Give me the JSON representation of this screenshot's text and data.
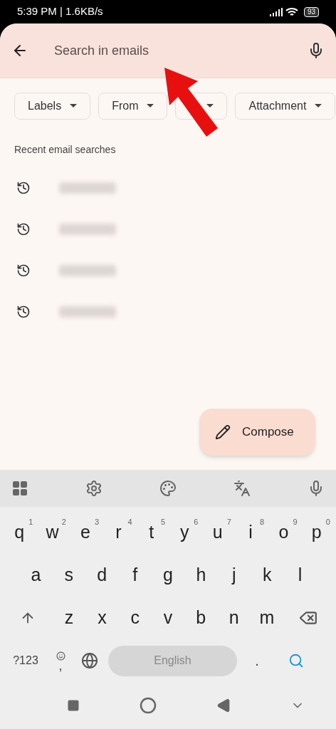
{
  "status_bar": {
    "time": "5:39 PM | 1.6KB/s",
    "battery": "93"
  },
  "search": {
    "placeholder": "Search in emails"
  },
  "filter_chips": [
    {
      "kind": "labeled",
      "label": "Labels"
    },
    {
      "kind": "labeled",
      "label": "From"
    },
    {
      "kind": "covered"
    },
    {
      "kind": "labeled",
      "label": "Attachment"
    }
  ],
  "recent_searches": {
    "title": "Recent email searches",
    "items": [
      {
        "kind": "redacted"
      },
      {
        "kind": "redacted"
      },
      {
        "kind": "redacted"
      },
      {
        "kind": "redacted"
      }
    ]
  },
  "compose_button": {
    "label": "Compose"
  },
  "keyboard": {
    "rows": [
      [
        {
          "key": "q",
          "hint": "1"
        },
        {
          "key": "w",
          "hint": "2"
        },
        {
          "key": "e",
          "hint": "3"
        },
        {
          "key": "r",
          "hint": "4"
        },
        {
          "key": "t",
          "hint": "5"
        },
        {
          "key": "y",
          "hint": "6"
        },
        {
          "key": "u",
          "hint": "7"
        },
        {
          "key": "i",
          "hint": "8"
        },
        {
          "key": "o",
          "hint": "9"
        },
        {
          "key": "p",
          "hint": "0"
        }
      ],
      [
        {
          "key": "a"
        },
        {
          "key": "s"
        },
        {
          "key": "d"
        },
        {
          "key": "f"
        },
        {
          "key": "g"
        },
        {
          "key": "h"
        },
        {
          "key": "j"
        },
        {
          "key": "k"
        },
        {
          "key": "l"
        }
      ],
      [
        {
          "key": "z"
        },
        {
          "key": "x"
        },
        {
          "key": "c"
        },
        {
          "key": "v"
        },
        {
          "key": "b"
        },
        {
          "key": "n"
        },
        {
          "key": "m"
        }
      ]
    ],
    "symbols_key": "?123",
    "comma_key": ",",
    "space_label": "English",
    "period_key": "."
  }
}
